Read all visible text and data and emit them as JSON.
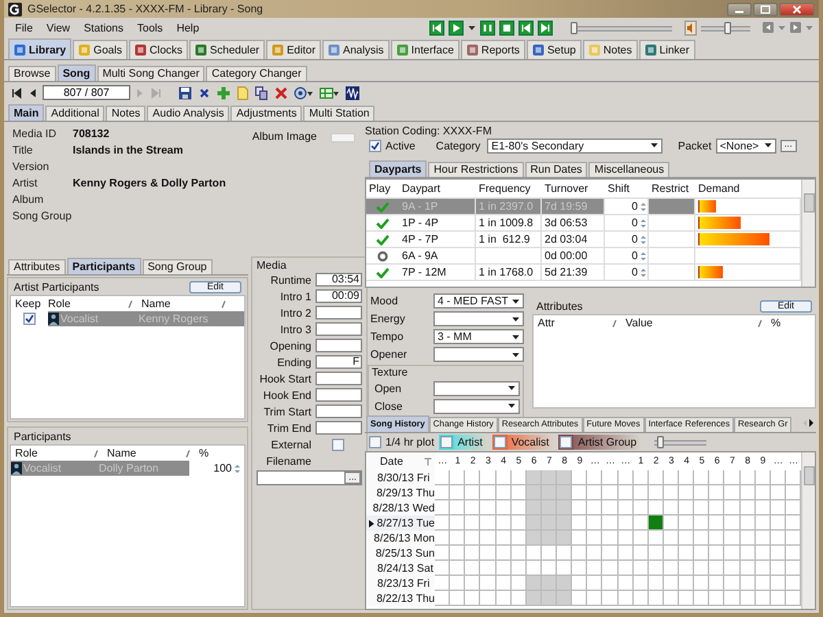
{
  "window": {
    "title": "GSelector - 4.2.1.35 - XXXX-FM - Library - Song"
  },
  "menu": [
    "File",
    "View",
    "Stations",
    "Tools",
    "Help"
  ],
  "transport": {
    "position": {
      "level": 0
    },
    "volume": {
      "level": 0.55
    }
  },
  "main_tabs": [
    {
      "label": "Library",
      "selected": true
    },
    {
      "label": "Goals",
      "selected": false
    },
    {
      "label": "Clocks",
      "selected": false
    },
    {
      "label": "Scheduler",
      "selected": false
    },
    {
      "label": "Editor",
      "selected": false
    },
    {
      "label": "Analysis",
      "selected": false
    },
    {
      "label": "Interface",
      "selected": false
    },
    {
      "label": "Reports",
      "selected": false
    },
    {
      "label": "Setup",
      "selected": false
    },
    {
      "label": "Notes",
      "selected": false
    },
    {
      "label": "Linker",
      "selected": false
    }
  ],
  "sub_tabs": [
    {
      "label": "Browse",
      "selected": false
    },
    {
      "label": "Song",
      "selected": true
    },
    {
      "label": "Multi Song Changer",
      "selected": false
    },
    {
      "label": "Category Changer",
      "selected": false
    }
  ],
  "record_field": {
    "value": "807 / 807"
  },
  "song_tabs": [
    {
      "label": "Main",
      "selected": true
    },
    {
      "label": "Additional",
      "selected": false
    },
    {
      "label": "Notes",
      "selected": false
    },
    {
      "label": "Audio Analysis",
      "selected": false
    },
    {
      "label": "Adjustments",
      "selected": false
    },
    {
      "label": "Multi Station",
      "selected": false
    }
  ],
  "song_info": {
    "fields": [
      {
        "label": "Media ID",
        "value": "708132"
      },
      {
        "label": "Title",
        "value": "Islands in the Stream"
      },
      {
        "label": "Version"
      },
      {
        "label": "Artist",
        "value": "Kenny Rogers & Dolly Parton"
      },
      {
        "label": "Album"
      },
      {
        "label": "Song Group"
      }
    ],
    "album_image_label": "Album Image"
  },
  "left_tabs": [
    {
      "label": "Attributes",
      "selected": false
    },
    {
      "label": "Participants",
      "selected": true
    },
    {
      "label": "Song Group",
      "selected": false
    }
  ],
  "artist_participants": {
    "title": "Artist Participants",
    "edit_button": "Edit",
    "columns": [
      "Keep",
      "Role",
      "Name"
    ],
    "rows": [
      {
        "keep": true,
        "role": "Vocalist",
        "name": "Kenny Rogers",
        "selected": true
      }
    ]
  },
  "participants": {
    "title": "Participants",
    "columns": [
      "Role",
      "Name",
      "%"
    ],
    "rows": [
      {
        "role": "Vocalist",
        "name": "Dolly Parton",
        "percent": "100",
        "selected": true
      }
    ]
  },
  "media": {
    "title": "Media",
    "fields": [
      {
        "label": "Runtime",
        "value": "03:54"
      },
      {
        "label": "Intro 1",
        "value": "00:09"
      },
      {
        "label": "Intro 2"
      },
      {
        "label": "Intro 3"
      },
      {
        "label": "Opening"
      },
      {
        "label": "Ending",
        "value": "F"
      },
      {
        "label": "Hook Start"
      },
      {
        "label": "Hook End"
      },
      {
        "label": "Trim Start"
      },
      {
        "label": "Trim End"
      }
    ],
    "external": {
      "label": "External",
      "checked": false
    },
    "filename_label": "Filename",
    "browse_button": "..."
  },
  "station": {
    "title": "Station Coding: XXXX-FM",
    "active": {
      "label": "Active",
      "checked": true
    },
    "category": {
      "label": "Category",
      "value": "E1-80's Secondary"
    },
    "packet": {
      "label": "Packet",
      "value": "<None>"
    },
    "packet_button": "..."
  },
  "station_tabs": [
    {
      "label": "Dayparts",
      "selected": true
    },
    {
      "label": "Hour Restrictions",
      "selected": false
    },
    {
      "label": "Run Dates",
      "selected": false
    },
    {
      "label": "Miscellaneous",
      "selected": false
    }
  ],
  "dayparts": {
    "columns": [
      "Play",
      "Daypart",
      "Frequency",
      "Turnover",
      "Shift",
      "Restrict",
      "Demand"
    ],
    "rows": [
      {
        "kind": "check",
        "daypart": "9A - 1P",
        "frequency": "1 in 2397.0",
        "turnover": "7d 19:59",
        "shift": "0",
        "level": 0.18,
        "selected": true
      },
      {
        "kind": "check",
        "daypart": "1P - 4P",
        "frequency": "1 in 1009.8",
        "turnover": "3d 06:53",
        "shift": "0",
        "level": 0.43,
        "selected": false
      },
      {
        "kind": "check",
        "daypart": "4P - 7P",
        "frequency": "1 in  612.9",
        "turnover": "2d 03:04",
        "shift": "0",
        "level": 0.72,
        "selected": false
      },
      {
        "kind": "ring",
        "daypart": "6A - 9A",
        "turnover": "0d 00:00",
        "shift": "0",
        "selected": false
      },
      {
        "kind": "check",
        "daypart": "7P - 12M",
        "frequency": "1 in 1768.0",
        "turnover": "5d 21:39",
        "shift": "0",
        "level": 0.25,
        "selected": false
      }
    ]
  },
  "moods": [
    {
      "label": "Mood",
      "value": "4 - MED FAST"
    },
    {
      "label": "Energy"
    },
    {
      "label": "Tempo",
      "value": "3 - MM"
    },
    {
      "label": "Opener"
    }
  ],
  "texture": {
    "title": "Texture",
    "fields": [
      {
        "label": "Open"
      },
      {
        "label": "Close"
      }
    ]
  },
  "attributes": {
    "title": "Attributes",
    "edit_button": "Edit",
    "columns": [
      "Attr",
      "Value",
      "%"
    ]
  },
  "history_tabs": [
    {
      "label": "Song History",
      "selected": true
    },
    {
      "label": "Change History",
      "selected": false
    },
    {
      "label": "Research Attributes",
      "selected": false
    },
    {
      "label": "Future Moves",
      "selected": false
    },
    {
      "label": "Interface References",
      "selected": false
    },
    {
      "label": "Research Gr",
      "selected": false
    }
  ],
  "history_legend": {
    "quarter_plot": {
      "label": "1/4 hr plot",
      "checked": false
    },
    "items": [
      {
        "label": "Artist",
        "checked": false,
        "color": "#40e0e0"
      },
      {
        "label": "Vocalist",
        "checked": false,
        "color": "#f06030"
      },
      {
        "label": "Artist Group",
        "checked": false,
        "color": "#804848"
      }
    ],
    "slider": {
      "level": 0.05
    }
  },
  "history": {
    "date_column": "Date",
    "hours": [
      {
        "label": "…",
        "restricted": false
      },
      {
        "label": "1",
        "restricted": false
      },
      {
        "label": "2",
        "restricted": false
      },
      {
        "label": "3",
        "restricted": false
      },
      {
        "label": "4",
        "restricted": false
      },
      {
        "label": "5",
        "restricted": false
      },
      {
        "label": "6",
        "restricted": true
      },
      {
        "label": "7",
        "restricted": true
      },
      {
        "label": "8",
        "restricted": true
      },
      {
        "label": "9",
        "restricted": false
      },
      {
        "label": "…",
        "restricted": false
      },
      {
        "label": "…",
        "restricted": false
      },
      {
        "label": "…",
        "restricted": false
      },
      {
        "label": "1",
        "restricted": false
      },
      {
        "label": "2",
        "restricted": false
      },
      {
        "label": "3",
        "restricted": false
      },
      {
        "label": "4",
        "restricted": false
      },
      {
        "label": "5",
        "restricted": false
      },
      {
        "label": "6",
        "restricted": false
      },
      {
        "label": "7",
        "restricted": false
      },
      {
        "label": "8",
        "restricted": false
      },
      {
        "label": "9",
        "restricted": false
      },
      {
        "label": "…",
        "restricted": false
      },
      {
        "label": "…",
        "restricted": false
      }
    ],
    "rows": [
      {
        "date": "8/30/13 Fri",
        "selected": false,
        "restricted": true,
        "played": [
          false,
          false,
          false,
          false,
          false,
          false,
          false,
          false,
          false,
          false,
          false,
          false,
          false,
          false,
          false,
          false,
          false,
          false,
          false,
          false,
          false,
          false,
          false,
          false
        ]
      },
      {
        "date": "8/29/13 Thu",
        "selected": false,
        "restricted": true,
        "played": [
          false,
          false,
          false,
          false,
          false,
          false,
          false,
          false,
          false,
          false,
          false,
          false,
          false,
          false,
          false,
          false,
          false,
          false,
          false,
          false,
          false,
          false,
          false,
          false
        ]
      },
      {
        "date": "8/28/13 Wed",
        "selected": false,
        "restricted": true,
        "played": [
          false,
          false,
          false,
          false,
          false,
          false,
          false,
          false,
          false,
          false,
          false,
          false,
          false,
          false,
          false,
          false,
          false,
          false,
          false,
          false,
          false,
          false,
          false,
          false
        ]
      },
      {
        "date": "8/27/13 Tue",
        "selected": true,
        "restricted": true,
        "played": [
          false,
          false,
          false,
          false,
          false,
          false,
          false,
          false,
          false,
          false,
          false,
          false,
          false,
          false,
          true,
          false,
          false,
          false,
          false,
          false,
          false,
          false,
          false,
          false
        ]
      },
      {
        "date": "8/26/13 Mon",
        "selected": false,
        "restricted": true,
        "played": [
          false,
          false,
          false,
          false,
          false,
          false,
          false,
          false,
          false,
          false,
          false,
          false,
          false,
          false,
          false,
          false,
          false,
          false,
          false,
          false,
          false,
          false,
          false,
          false
        ]
      },
      {
        "date": "8/25/13 Sun",
        "selected": false,
        "restricted": false,
        "played": [
          false,
          false,
          false,
          false,
          false,
          false,
          false,
          false,
          false,
          false,
          false,
          false,
          false,
          false,
          false,
          false,
          false,
          false,
          false,
          false,
          false,
          false,
          false,
          false
        ]
      },
      {
        "date": "8/24/13 Sat",
        "selected": false,
        "restricted": false,
        "played": [
          false,
          false,
          false,
          false,
          false,
          false,
          false,
          false,
          false,
          false,
          false,
          false,
          false,
          false,
          false,
          false,
          false,
          false,
          false,
          false,
          false,
          false,
          false,
          false
        ]
      },
      {
        "date": "8/23/13 Fri",
        "selected": false,
        "restricted": true,
        "played": [
          false,
          false,
          false,
          false,
          false,
          false,
          false,
          false,
          false,
          false,
          false,
          false,
          false,
          false,
          false,
          false,
          false,
          false,
          false,
          false,
          false,
          false,
          false,
          false
        ]
      },
      {
        "date": "8/22/13 Thu",
        "selected": false,
        "restricted": true,
        "played": [
          false,
          false,
          false,
          false,
          false,
          false,
          false,
          false,
          false,
          false,
          false,
          false,
          false,
          false,
          false,
          false,
          false,
          false,
          false,
          false,
          false,
          false,
          false,
          false
        ]
      }
    ]
  }
}
